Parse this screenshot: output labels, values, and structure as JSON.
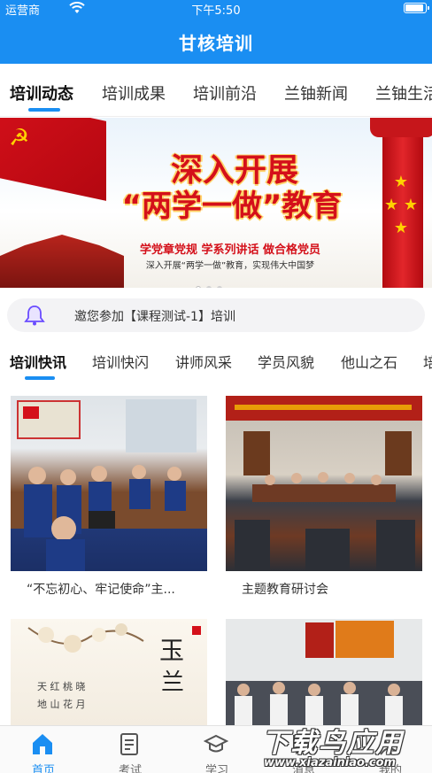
{
  "status_bar": {
    "carrier": "运营商",
    "time": "下午5:50"
  },
  "nav": {
    "title": "甘核培训"
  },
  "top_tabs": [
    "培训动态",
    "培训成果",
    "培训前沿",
    "兰铀新闻",
    "兰铀生活"
  ],
  "banner": {
    "headline_1": "深入开展",
    "headline_2": "“两学一做”教育",
    "slogan": "学党章党规  学系列讲话  做合格党员",
    "subline": "深入开展“两学一做”教育，实现伟大中国梦"
  },
  "notice": {
    "text": "邀您参加【课程测试-1】培训",
    "icon": "bell-icon"
  },
  "sub_tabs": [
    "培训快讯",
    "培训快闪",
    "讲师风采",
    "学员风貌",
    "他山之石",
    "培训"
  ],
  "cards": [
    {
      "title": "“不忘初心、牢记使命”主..."
    },
    {
      "title": "主题教育研讨会"
    },
    {
      "title": ""
    },
    {
      "title": ""
    }
  ],
  "tab_bar": [
    {
      "label": "首页",
      "icon": "home-icon",
      "active": true
    },
    {
      "label": "考试",
      "icon": "exam-icon",
      "active": false
    },
    {
      "label": "学习",
      "icon": "graduation-cap-icon",
      "active": false
    },
    {
      "label": "消息",
      "icon": "message-icon",
      "active": false
    },
    {
      "label": "我的",
      "icon": "user-icon",
      "active": false
    }
  ],
  "watermark": {
    "brand": "下载鸟应用",
    "url": "www.xiazainiao.com"
  },
  "colors": {
    "primary": "#1a8ef2",
    "banner_red": "#d4101a",
    "gold": "#ffd200"
  }
}
